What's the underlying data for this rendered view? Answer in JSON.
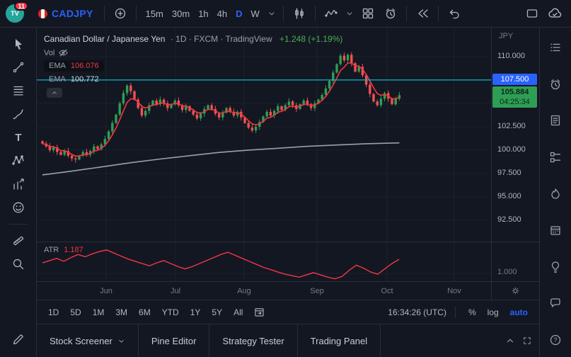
{
  "colors": {
    "up": "#2f9e55",
    "down": "#ef5350",
    "ema_fast": "#f23645",
    "ema_slow": "#9aa0aa",
    "alert_line": "#00bcd4",
    "atr_line": "#f23645",
    "accent": "#2962ff",
    "gain": "#4caf50",
    "grid": "rgba(134,142,162,0.08)"
  },
  "header": {
    "notifications": "11",
    "logo_text": "TV",
    "symbol": "CADJPY",
    "timeframes": [
      "15m",
      "30m",
      "1h",
      "4h",
      "D",
      "W"
    ],
    "active_timeframe": "D"
  },
  "legend": {
    "title": "Canadian Dollar / Japanese Yen",
    "meta": "· 1D · FXCM · TradingView",
    "change": "+1.248 (+1.19%)",
    "vol_label": "Vol",
    "emas": [
      {
        "label": "EMA",
        "value": "106.076"
      },
      {
        "label": "EMA",
        "value": "100.772"
      }
    ]
  },
  "axis": {
    "currency": "JPY",
    "levels": [
      {
        "p": 110.0,
        "t": "110.000"
      },
      {
        "p": 102.5,
        "t": "102.500"
      },
      {
        "p": 100.0,
        "t": "100.000"
      },
      {
        "p": 97.5,
        "t": "97.500"
      },
      {
        "p": 95.0,
        "t": "95.000"
      },
      {
        "p": 92.5,
        "t": "92.500"
      }
    ],
    "alert": {
      "p": 107.5,
      "t": "107.500"
    },
    "last": {
      "p": 105.884,
      "t": "105.884",
      "countdown": "04:25:34"
    },
    "atr_level": {
      "v": 1.0,
      "t": "1.000"
    }
  },
  "months": [
    {
      "t": "Jun",
      "x": 98
    },
    {
      "t": "Jul",
      "x": 196
    },
    {
      "t": "Aug",
      "x": 293
    },
    {
      "t": "Sep",
      "x": 396
    },
    {
      "t": "Oct",
      "x": 495
    },
    {
      "t": "Nov",
      "x": 590
    }
  ],
  "atr": {
    "label": "ATR",
    "value": "1.187"
  },
  "range_bar": {
    "ranges": [
      "1D",
      "5D",
      "1M",
      "3M",
      "6M",
      "YTD",
      "1Y",
      "5Y",
      "All"
    ],
    "clock": "16:34:26 (UTC)",
    "percent": "%",
    "log": "log",
    "auto": "auto"
  },
  "tabs": [
    {
      "label": "Stock Screener",
      "chevron": true
    },
    {
      "label": "Pine Editor",
      "chevron": false
    },
    {
      "label": "Strategy Tester",
      "chevron": false
    },
    {
      "label": "Trading Panel",
      "chevron": false
    }
  ],
  "chart_data": {
    "type": "candlestick",
    "symbol": "CADJPY",
    "interval": "1D",
    "title": "Canadian Dollar / Japanese Yen · 1D · FXCM",
    "ylim": [
      90.2,
      113.1
    ],
    "price_axis": [
      110.0,
      107.5,
      105.0,
      102.5,
      100.0,
      97.5,
      95.0,
      92.5
    ],
    "alert_price": 107.5,
    "last_price": 105.884,
    "closes": [
      100.7,
      100.4,
      100.0,
      100.3,
      99.8,
      99.5,
      99.9,
      99.4,
      99.1,
      99.0,
      99.4,
      99.8,
      99.5,
      99.9,
      100.4,
      100.1,
      100.6,
      101.2,
      102.0,
      102.9,
      103.8,
      105.0,
      106.1,
      106.9,
      106.3,
      105.4,
      104.5,
      103.7,
      104.2,
      104.8,
      105.3,
      104.9,
      105.4,
      105.0,
      104.5,
      104.9,
      105.3,
      104.8,
      104.3,
      104.7,
      104.2,
      103.8,
      103.4,
      103.9,
      104.4,
      104.8,
      104.4,
      103.9,
      103.5,
      104.0,
      104.5,
      104.1,
      103.7,
      104.1,
      103.5,
      102.9,
      102.4,
      102.1,
      102.5,
      103.0,
      103.6,
      104.1,
      103.7,
      104.2,
      104.7,
      104.3,
      104.8,
      105.2,
      104.8,
      104.4,
      104.9,
      105.3,
      104.9,
      104.5,
      105.0,
      105.4,
      105.9,
      106.6,
      107.4,
      108.3,
      109.2,
      110.1,
      109.6,
      110.2,
      109.3,
      108.4,
      108.9,
      108.0,
      107.0,
      106.0,
      105.2,
      104.8,
      105.5,
      106.1,
      105.5,
      104.9,
      105.5,
      105.884
    ],
    "ema_fast_period": 5,
    "ema_slow_points": [
      [
        0,
        97.35
      ],
      [
        8,
        97.75
      ],
      [
        16,
        98.2
      ],
      [
        24,
        98.65
      ],
      [
        32,
        99.05
      ],
      [
        40,
        99.4
      ],
      [
        48,
        99.75
      ],
      [
        56,
        100.0
      ],
      [
        64,
        100.2
      ],
      [
        72,
        100.4
      ],
      [
        80,
        100.55
      ],
      [
        88,
        100.68
      ],
      [
        97,
        100.772
      ]
    ],
    "atr_values": [
      1.14,
      1.17,
      1.2,
      1.16,
      1.21,
      1.25,
      1.22,
      1.26,
      1.29,
      1.31,
      1.27,
      1.23,
      1.19,
      1.16,
      1.13,
      1.1,
      1.14,
      1.17,
      1.13,
      1.09,
      1.06,
      1.09,
      1.13,
      1.17,
      1.21,
      1.25,
      1.28,
      1.24,
      1.2,
      1.16,
      1.12,
      1.08,
      1.05,
      1.02,
      0.99,
      0.97,
      0.95,
      0.98,
      1.01,
      0.98,
      0.95,
      0.93,
      0.96,
      1.04,
      1.11,
      1.07,
      1.02,
      0.99,
      1.06,
      1.13,
      1.187
    ]
  }
}
